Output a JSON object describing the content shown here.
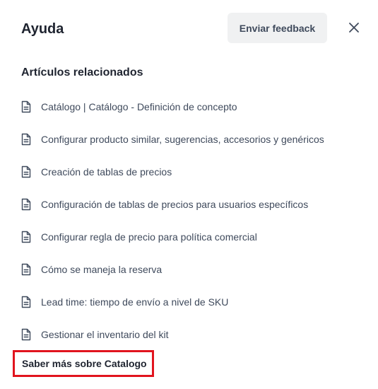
{
  "header": {
    "title": "Ayuda",
    "feedback_label": "Enviar feedback",
    "close_icon": "close-icon"
  },
  "related": {
    "title": "Artículos relacionados",
    "icon": "document-icon",
    "items": [
      {
        "label": "Catálogo | Catálogo - Definición de concepto"
      },
      {
        "label": "Configurar producto similar, sugerencias, accesorios y genéricos"
      },
      {
        "label": "Creación de tablas de precios"
      },
      {
        "label": "Configuración de tablas de precios para usuarios específicos"
      },
      {
        "label": "Configurar regla de precio para política comercial"
      },
      {
        "label": "Cómo se maneja la reserva"
      },
      {
        "label": "Lead time: tiempo de envío a nivel de SKU"
      },
      {
        "label": "Gestionar el inventario del kit"
      }
    ]
  },
  "footer": {
    "learn_more_label": "Saber más sobre Catalogo",
    "highlight_color": "#e1141e"
  }
}
